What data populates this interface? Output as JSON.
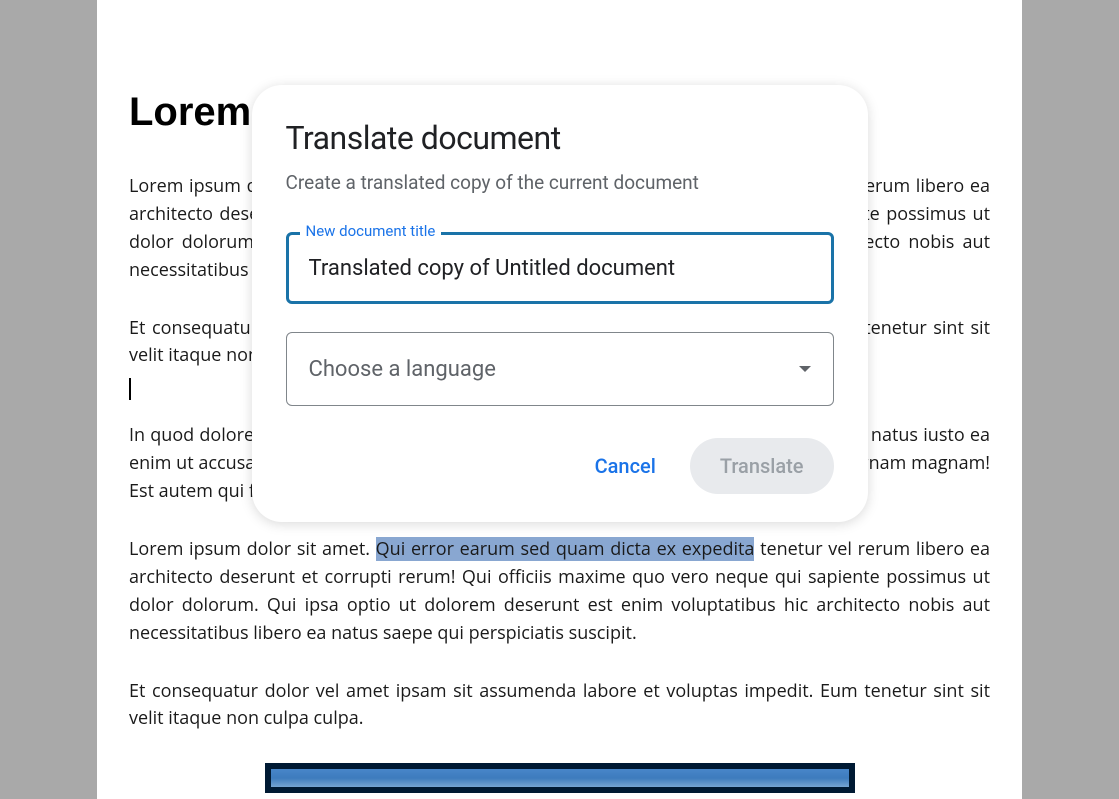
{
  "document": {
    "heading": "Lorem Ipsum",
    "p1": "Lorem ipsum dolor sit amet. Qui error earum sed quam dicta ex expedita tenetur vel rerum libero ea architecto deserunt et corrupti rerum! Qui officiis maxime quo vero neque qui sapiente possimus ut dolor dolorum. Qui ipsa optio ut dolorem deserunt est enim voluptatibus hic architecto nobis aut necessitatibus libero ea natus saepe qui perspiciatis suscipit.",
    "p2": "Et consequatur dolor vel amet ipsam sit assumenda labore et voluptas impedit. Eum tenetur sint sit velit itaque non culpa culpa.",
    "p3": "In quod dolore ut autem tenetur ut amet odit qui praesentium sint? Est ratione enim et natus iusto ea enim ut accusamus eligendi. Est alias galisum ut omnis quia sit dolorum autem quo magnam magnam! Est autem qui fugiat quasi sit assumenda esse aut.",
    "p4_before": "Lorem ipsum dolor sit amet. ",
    "p4_highlight": "Qui error earum sed quam dicta ex expedita",
    "p4_after": " tenetur vel rerum libero ea architecto deserunt et corrupti rerum! Qui officiis maxime quo vero neque qui sapiente possimus ut dolor dolorum. Qui ipsa optio ut dolorem deserunt est enim voluptatibus hic architecto nobis aut necessitatibus libero ea natus saepe qui perspiciatis suscipit.",
    "p5": "Et consequatur dolor vel amet ipsam sit assumenda labore et voluptas impedit. Eum tenetur sint sit velit itaque non culpa culpa."
  },
  "dialog": {
    "title": "Translate document",
    "subtitle": "Create a translated copy of the current document",
    "field_label": "New document title",
    "title_value": "Translated copy of Untitled document",
    "language_placeholder": "Choose a language",
    "cancel_label": "Cancel",
    "translate_label": "Translate"
  }
}
